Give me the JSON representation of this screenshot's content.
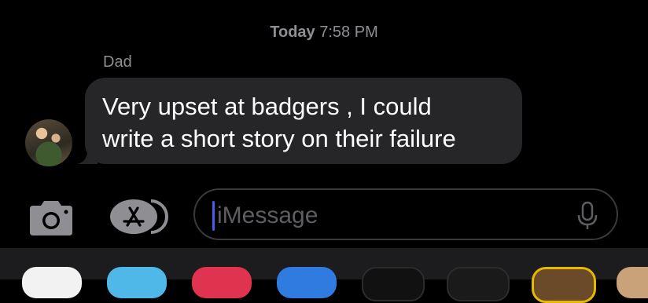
{
  "timestamp": {
    "day": "Today",
    "time": "7:58 PM"
  },
  "thread": {
    "sender_name": "Dad",
    "message_line1": "Very upset at badgers , I could",
    "message_line2": "write a short story on their failure"
  },
  "composer": {
    "placeholder": "iMessage"
  },
  "icons": {
    "camera": "camera-icon",
    "app_store": "app-store-icon",
    "microphone": "microphone-icon"
  },
  "colors": {
    "background": "#000000",
    "bubble": "#262628",
    "secondary_text": "#8e8e93",
    "cursor": "#4a5cf0"
  },
  "app_drawer": [
    "photos-app-icon",
    "memoji-app-icon",
    "digital-touch-app-icon",
    "audio-app-icon",
    "music-app-icon",
    "fitness-app-icon",
    "memoji-sticker-app-icon",
    "more-app-icon"
  ]
}
